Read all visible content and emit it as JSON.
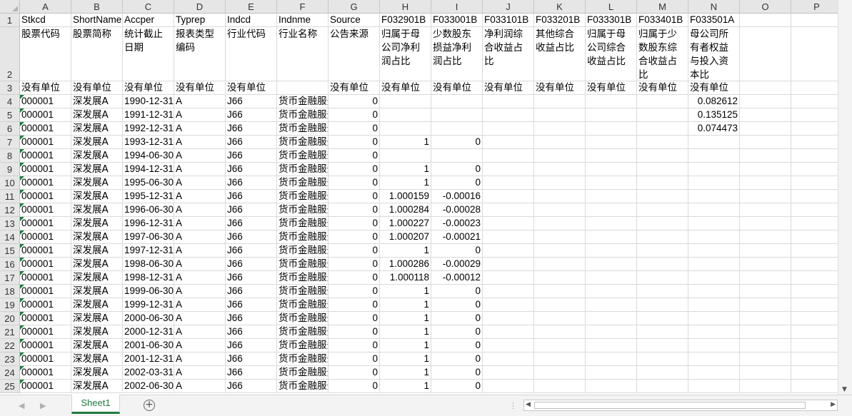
{
  "columns": [
    "A",
    "B",
    "C",
    "D",
    "E",
    "F",
    "G",
    "H",
    "I",
    "J",
    "K",
    "L",
    "M",
    "N",
    "O",
    "P"
  ],
  "rows": [
    {
      "num": "1",
      "cells": [
        {
          "t": "Stkcd"
        },
        {
          "t": "ShortName"
        },
        {
          "t": "Accper"
        },
        {
          "t": "Typrep"
        },
        {
          "t": "Indcd"
        },
        {
          "t": "Indnme"
        },
        {
          "t": "Source"
        },
        {
          "t": "F032901B"
        },
        {
          "t": "F033001B"
        },
        {
          "t": "F033101B"
        },
        {
          "t": "F033201B"
        },
        {
          "t": "F033301B"
        },
        {
          "t": "F033401B"
        },
        {
          "t": "F033501A"
        },
        {
          "t": ""
        },
        {
          "t": ""
        }
      ]
    },
    {
      "num": "2",
      "cells": [
        {
          "t": "股票代码"
        },
        {
          "t": "股票简称"
        },
        {
          "t": "统计截止日期",
          "wrap": true
        },
        {
          "t": "报表类型编码",
          "wrap": true
        },
        {
          "t": "行业代码"
        },
        {
          "t": "行业名称"
        },
        {
          "t": "公告来源"
        },
        {
          "t": "归属于母公司净利润占比",
          "wrap": true
        },
        {
          "t": "少数股东损益净利润占比",
          "wrap": true
        },
        {
          "t": "净利润综合收益占比",
          "wrap": true
        },
        {
          "t": "其他综合收益占比",
          "wrap": true
        },
        {
          "t": "归属于母公司综合收益占比",
          "wrap": true
        },
        {
          "t": "归属于少数股东综合收益占比",
          "wrap": true
        },
        {
          "t": "母公司所有者权益与投入资本比",
          "wrap": true
        },
        {
          "t": ""
        },
        {
          "t": ""
        }
      ]
    },
    {
      "num": "3",
      "cells": [
        {
          "t": "没有单位"
        },
        {
          "t": "没有单位"
        },
        {
          "t": "没有单位"
        },
        {
          "t": "没有单位"
        },
        {
          "t": "没有单位"
        },
        {
          "t": ""
        },
        {
          "t": "没有单位"
        },
        {
          "t": "没有单位"
        },
        {
          "t": "没有单位"
        },
        {
          "t": "没有单位"
        },
        {
          "t": "没有单位"
        },
        {
          "t": "没有单位"
        },
        {
          "t": "没有单位"
        },
        {
          "t": "没有单位"
        },
        {
          "t": ""
        },
        {
          "t": ""
        }
      ]
    },
    {
      "num": "4",
      "cells": [
        {
          "t": "000001"
        },
        {
          "t": "深发展A"
        },
        {
          "t": "1990-12-31"
        },
        {
          "t": "A"
        },
        {
          "t": "J66"
        },
        {
          "t": "货币金融服务"
        },
        {
          "t": "0"
        },
        {
          "t": ""
        },
        {
          "t": ""
        },
        {
          "t": ""
        },
        {
          "t": ""
        },
        {
          "t": ""
        },
        {
          "t": ""
        },
        {
          "t": "0.082612"
        },
        {
          "t": ""
        },
        {
          "t": ""
        }
      ]
    },
    {
      "num": "5",
      "cells": [
        {
          "t": "000001"
        },
        {
          "t": "深发展A"
        },
        {
          "t": "1991-12-31"
        },
        {
          "t": "A"
        },
        {
          "t": "J66"
        },
        {
          "t": "货币金融服务"
        },
        {
          "t": "0"
        },
        {
          "t": ""
        },
        {
          "t": ""
        },
        {
          "t": ""
        },
        {
          "t": ""
        },
        {
          "t": ""
        },
        {
          "t": ""
        },
        {
          "t": "0.135125"
        },
        {
          "t": ""
        },
        {
          "t": ""
        }
      ]
    },
    {
      "num": "6",
      "cells": [
        {
          "t": "000001"
        },
        {
          "t": "深发展A"
        },
        {
          "t": "1992-12-31"
        },
        {
          "t": "A"
        },
        {
          "t": "J66"
        },
        {
          "t": "货币金融服务"
        },
        {
          "t": "0"
        },
        {
          "t": ""
        },
        {
          "t": ""
        },
        {
          "t": ""
        },
        {
          "t": ""
        },
        {
          "t": ""
        },
        {
          "t": ""
        },
        {
          "t": "0.074473"
        },
        {
          "t": ""
        },
        {
          "t": ""
        }
      ]
    },
    {
      "num": "7",
      "cells": [
        {
          "t": "000001"
        },
        {
          "t": "深发展A"
        },
        {
          "t": "1993-12-31"
        },
        {
          "t": "A"
        },
        {
          "t": "J66"
        },
        {
          "t": "货币金融服务"
        },
        {
          "t": "0"
        },
        {
          "t": "1"
        },
        {
          "t": "0"
        },
        {
          "t": ""
        },
        {
          "t": ""
        },
        {
          "t": ""
        },
        {
          "t": ""
        },
        {
          "t": ""
        },
        {
          "t": ""
        },
        {
          "t": ""
        }
      ]
    },
    {
      "num": "8",
      "cells": [
        {
          "t": "000001"
        },
        {
          "t": "深发展A"
        },
        {
          "t": "1994-06-30"
        },
        {
          "t": "A"
        },
        {
          "t": "J66"
        },
        {
          "t": "货币金融服务"
        },
        {
          "t": "0"
        },
        {
          "t": ""
        },
        {
          "t": ""
        },
        {
          "t": ""
        },
        {
          "t": ""
        },
        {
          "t": ""
        },
        {
          "t": ""
        },
        {
          "t": ""
        },
        {
          "t": ""
        },
        {
          "t": ""
        }
      ]
    },
    {
      "num": "9",
      "cells": [
        {
          "t": "000001"
        },
        {
          "t": "深发展A"
        },
        {
          "t": "1994-12-31"
        },
        {
          "t": "A"
        },
        {
          "t": "J66"
        },
        {
          "t": "货币金融服务"
        },
        {
          "t": "0"
        },
        {
          "t": "1"
        },
        {
          "t": "0"
        },
        {
          "t": ""
        },
        {
          "t": ""
        },
        {
          "t": ""
        },
        {
          "t": ""
        },
        {
          "t": ""
        },
        {
          "t": ""
        },
        {
          "t": ""
        }
      ]
    },
    {
      "num": "10",
      "cells": [
        {
          "t": "000001"
        },
        {
          "t": "深发展A"
        },
        {
          "t": "1995-06-30"
        },
        {
          "t": "A"
        },
        {
          "t": "J66"
        },
        {
          "t": "货币金融服务"
        },
        {
          "t": "0"
        },
        {
          "t": "1"
        },
        {
          "t": "0"
        },
        {
          "t": ""
        },
        {
          "t": ""
        },
        {
          "t": ""
        },
        {
          "t": ""
        },
        {
          "t": ""
        },
        {
          "t": ""
        },
        {
          "t": ""
        }
      ]
    },
    {
      "num": "11",
      "cells": [
        {
          "t": "000001"
        },
        {
          "t": "深发展A"
        },
        {
          "t": "1995-12-31"
        },
        {
          "t": "A"
        },
        {
          "t": "J66"
        },
        {
          "t": "货币金融服务"
        },
        {
          "t": "0"
        },
        {
          "t": "1.000159"
        },
        {
          "t": "-0.00016"
        },
        {
          "t": ""
        },
        {
          "t": ""
        },
        {
          "t": ""
        },
        {
          "t": ""
        },
        {
          "t": ""
        },
        {
          "t": ""
        },
        {
          "t": ""
        }
      ]
    },
    {
      "num": "12",
      "cells": [
        {
          "t": "000001"
        },
        {
          "t": "深发展A"
        },
        {
          "t": "1996-06-30"
        },
        {
          "t": "A"
        },
        {
          "t": "J66"
        },
        {
          "t": "货币金融服务"
        },
        {
          "t": "0"
        },
        {
          "t": "1.000284"
        },
        {
          "t": "-0.00028"
        },
        {
          "t": ""
        },
        {
          "t": ""
        },
        {
          "t": ""
        },
        {
          "t": ""
        },
        {
          "t": ""
        },
        {
          "t": ""
        },
        {
          "t": ""
        }
      ]
    },
    {
      "num": "13",
      "cells": [
        {
          "t": "000001"
        },
        {
          "t": "深发展A"
        },
        {
          "t": "1996-12-31"
        },
        {
          "t": "A"
        },
        {
          "t": "J66"
        },
        {
          "t": "货币金融服务"
        },
        {
          "t": "0"
        },
        {
          "t": "1.000227"
        },
        {
          "t": "-0.00023"
        },
        {
          "t": ""
        },
        {
          "t": ""
        },
        {
          "t": ""
        },
        {
          "t": ""
        },
        {
          "t": ""
        },
        {
          "t": ""
        },
        {
          "t": ""
        }
      ]
    },
    {
      "num": "14",
      "cells": [
        {
          "t": "000001"
        },
        {
          "t": "深发展A"
        },
        {
          "t": "1997-06-30"
        },
        {
          "t": "A"
        },
        {
          "t": "J66"
        },
        {
          "t": "货币金融服务"
        },
        {
          "t": "0"
        },
        {
          "t": "1.000207"
        },
        {
          "t": "-0.00021"
        },
        {
          "t": ""
        },
        {
          "t": ""
        },
        {
          "t": ""
        },
        {
          "t": ""
        },
        {
          "t": ""
        },
        {
          "t": ""
        },
        {
          "t": ""
        }
      ]
    },
    {
      "num": "15",
      "cells": [
        {
          "t": "000001"
        },
        {
          "t": "深发展A"
        },
        {
          "t": "1997-12-31"
        },
        {
          "t": "A"
        },
        {
          "t": "J66"
        },
        {
          "t": "货币金融服务"
        },
        {
          "t": "0"
        },
        {
          "t": "1"
        },
        {
          "t": "0"
        },
        {
          "t": ""
        },
        {
          "t": ""
        },
        {
          "t": ""
        },
        {
          "t": ""
        },
        {
          "t": ""
        },
        {
          "t": ""
        },
        {
          "t": ""
        }
      ]
    },
    {
      "num": "16",
      "cells": [
        {
          "t": "000001"
        },
        {
          "t": "深发展A"
        },
        {
          "t": "1998-06-30"
        },
        {
          "t": "A"
        },
        {
          "t": "J66"
        },
        {
          "t": "货币金融服务"
        },
        {
          "t": "0"
        },
        {
          "t": "1.000286"
        },
        {
          "t": "-0.00029"
        },
        {
          "t": ""
        },
        {
          "t": ""
        },
        {
          "t": ""
        },
        {
          "t": ""
        },
        {
          "t": ""
        },
        {
          "t": ""
        },
        {
          "t": ""
        }
      ]
    },
    {
      "num": "17",
      "cells": [
        {
          "t": "000001"
        },
        {
          "t": "深发展A"
        },
        {
          "t": "1998-12-31"
        },
        {
          "t": "A"
        },
        {
          "t": "J66"
        },
        {
          "t": "货币金融服务"
        },
        {
          "t": "0"
        },
        {
          "t": "1.000118"
        },
        {
          "t": "-0.00012"
        },
        {
          "t": ""
        },
        {
          "t": ""
        },
        {
          "t": ""
        },
        {
          "t": ""
        },
        {
          "t": ""
        },
        {
          "t": ""
        },
        {
          "t": ""
        }
      ]
    },
    {
      "num": "18",
      "cells": [
        {
          "t": "000001"
        },
        {
          "t": "深发展A"
        },
        {
          "t": "1999-06-30"
        },
        {
          "t": "A"
        },
        {
          "t": "J66"
        },
        {
          "t": "货币金融服务"
        },
        {
          "t": "0"
        },
        {
          "t": "1"
        },
        {
          "t": "0"
        },
        {
          "t": ""
        },
        {
          "t": ""
        },
        {
          "t": ""
        },
        {
          "t": ""
        },
        {
          "t": ""
        },
        {
          "t": ""
        },
        {
          "t": ""
        }
      ]
    },
    {
      "num": "19",
      "cells": [
        {
          "t": "000001"
        },
        {
          "t": "深发展A"
        },
        {
          "t": "1999-12-31"
        },
        {
          "t": "A"
        },
        {
          "t": "J66"
        },
        {
          "t": "货币金融服务"
        },
        {
          "t": "0"
        },
        {
          "t": "1"
        },
        {
          "t": "0"
        },
        {
          "t": ""
        },
        {
          "t": ""
        },
        {
          "t": ""
        },
        {
          "t": ""
        },
        {
          "t": ""
        },
        {
          "t": ""
        },
        {
          "t": ""
        }
      ]
    },
    {
      "num": "20",
      "cells": [
        {
          "t": "000001"
        },
        {
          "t": "深发展A"
        },
        {
          "t": "2000-06-30"
        },
        {
          "t": "A"
        },
        {
          "t": "J66"
        },
        {
          "t": "货币金融服务"
        },
        {
          "t": "0"
        },
        {
          "t": "1"
        },
        {
          "t": "0"
        },
        {
          "t": ""
        },
        {
          "t": ""
        },
        {
          "t": ""
        },
        {
          "t": ""
        },
        {
          "t": ""
        },
        {
          "t": ""
        },
        {
          "t": ""
        }
      ]
    },
    {
      "num": "21",
      "cells": [
        {
          "t": "000001"
        },
        {
          "t": "深发展A"
        },
        {
          "t": "2000-12-31"
        },
        {
          "t": "A"
        },
        {
          "t": "J66"
        },
        {
          "t": "货币金融服务"
        },
        {
          "t": "0"
        },
        {
          "t": "1"
        },
        {
          "t": "0"
        },
        {
          "t": ""
        },
        {
          "t": ""
        },
        {
          "t": ""
        },
        {
          "t": ""
        },
        {
          "t": ""
        },
        {
          "t": ""
        },
        {
          "t": ""
        }
      ]
    },
    {
      "num": "22",
      "cells": [
        {
          "t": "000001"
        },
        {
          "t": "深发展A"
        },
        {
          "t": "2001-06-30"
        },
        {
          "t": "A"
        },
        {
          "t": "J66"
        },
        {
          "t": "货币金融服务"
        },
        {
          "t": "0"
        },
        {
          "t": "1"
        },
        {
          "t": "0"
        },
        {
          "t": ""
        },
        {
          "t": ""
        },
        {
          "t": ""
        },
        {
          "t": ""
        },
        {
          "t": ""
        },
        {
          "t": ""
        },
        {
          "t": ""
        }
      ]
    },
    {
      "num": "23",
      "cells": [
        {
          "t": "000001"
        },
        {
          "t": "深发展A"
        },
        {
          "t": "2001-12-31"
        },
        {
          "t": "A"
        },
        {
          "t": "J66"
        },
        {
          "t": "货币金融服务"
        },
        {
          "t": "0"
        },
        {
          "t": "1"
        },
        {
          "t": "0"
        },
        {
          "t": ""
        },
        {
          "t": ""
        },
        {
          "t": ""
        },
        {
          "t": ""
        },
        {
          "t": ""
        },
        {
          "t": ""
        },
        {
          "t": ""
        }
      ]
    },
    {
      "num": "24",
      "cells": [
        {
          "t": "000001"
        },
        {
          "t": "深发展A"
        },
        {
          "t": "2002-03-31"
        },
        {
          "t": "A"
        },
        {
          "t": "J66"
        },
        {
          "t": "货币金融服务"
        },
        {
          "t": "0"
        },
        {
          "t": "1"
        },
        {
          "t": "0"
        },
        {
          "t": ""
        },
        {
          "t": ""
        },
        {
          "t": ""
        },
        {
          "t": ""
        },
        {
          "t": ""
        },
        {
          "t": ""
        },
        {
          "t": ""
        }
      ]
    },
    {
      "num": "25",
      "cells": [
        {
          "t": "000001"
        },
        {
          "t": "深发展A"
        },
        {
          "t": "2002-06-30"
        },
        {
          "t": "A"
        },
        {
          "t": "J66"
        },
        {
          "t": "货币金融服务"
        },
        {
          "t": "0"
        },
        {
          "t": "1"
        },
        {
          "t": "0"
        },
        {
          "t": ""
        },
        {
          "t": ""
        },
        {
          "t": ""
        },
        {
          "t": ""
        },
        {
          "t": ""
        },
        {
          "t": ""
        },
        {
          "t": ""
        }
      ]
    }
  ],
  "sheet_tab": "Sheet1",
  "icons": {
    "add_sheet": "plus-circle-icon",
    "prev_sheet": "triangle-left-icon",
    "next_sheet": "triangle-right-icon"
  },
  "colors": {
    "accent": "#1f7a3f",
    "error_triangle": "#1f7a3f"
  }
}
